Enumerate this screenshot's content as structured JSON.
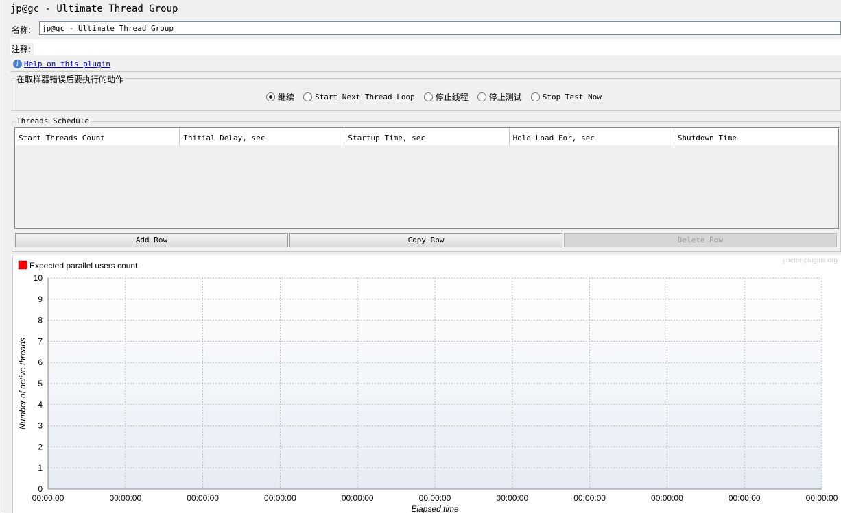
{
  "window": {
    "title": "jp@gc - Ultimate Thread Group"
  },
  "name_row": {
    "label": "名称:",
    "value": "jp@gc - Ultimate Thread Group"
  },
  "comment_row": {
    "label": "注释:"
  },
  "help": {
    "icon": "info-icon",
    "link": "Help on this plugin"
  },
  "error_action": {
    "legend": "在取样器错误后要执行的动作",
    "options": [
      "继续",
      "Start Next Thread Loop",
      "停止线程",
      "停止测试",
      "Stop Test Now"
    ],
    "selected": "继续"
  },
  "schedule": {
    "legend": "Threads Schedule",
    "columns": [
      "Start Threads Count",
      "Initial Delay, sec",
      "Startup Time, sec",
      "Hold Load For, sec",
      "Shutdown Time"
    ],
    "rows": [],
    "buttons": {
      "add": "Add Row",
      "copy": "Copy Row",
      "delete": "Delete Row"
    }
  },
  "chart_data": {
    "type": "line",
    "legend": [
      "Expected parallel users count"
    ],
    "series_color": "#ff0000",
    "watermark": "jmeter-plugins.org",
    "ylabel": "Number of active threads",
    "xlabel": "Elapsed time",
    "yticks": [
      "0",
      "1",
      "2",
      "3",
      "4",
      "5",
      "6",
      "7",
      "8",
      "9",
      "10"
    ],
    "xticks": [
      "00:00:00",
      "00:00:00",
      "00:00:00",
      "00:00:00",
      "00:00:00",
      "00:00:00",
      "00:00:00",
      "00:00:00",
      "00:00:00",
      "00:00:00",
      "00:00:00"
    ],
    "ylim": [
      0,
      10
    ],
    "grid": true,
    "series": [
      {
        "name": "Expected parallel users count",
        "values": []
      }
    ]
  }
}
